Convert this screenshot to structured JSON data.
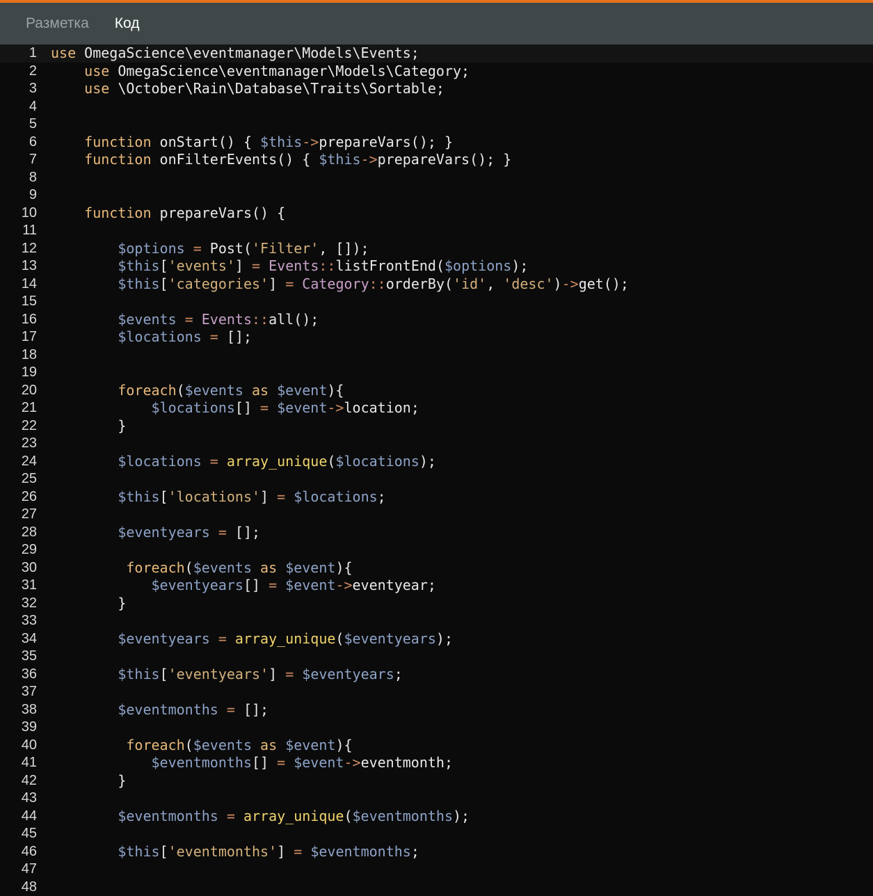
{
  "tabs": [
    {
      "label": "Разметка",
      "active": false
    },
    {
      "label": "Код",
      "active": true
    }
  ],
  "colors": {
    "accent": "#e8711d",
    "tabbar": "#3f4748",
    "editor_bg": "#0b0b0b"
  },
  "active_line": 1,
  "lines": [
    [
      [
        "kw",
        "use"
      ],
      [
        "plain",
        " OmegaScience\\eventmanager\\Models\\Events;"
      ]
    ],
    [
      [
        "plain",
        "    "
      ],
      [
        "kw",
        "use"
      ],
      [
        "plain",
        " OmegaScience\\eventmanager\\Models\\Category;"
      ]
    ],
    [
      [
        "plain",
        "    "
      ],
      [
        "kw",
        "use"
      ],
      [
        "plain",
        " \\October\\Rain\\Database\\Traits\\Sortable;"
      ]
    ],
    [],
    [],
    [
      [
        "plain",
        "    "
      ],
      [
        "kw",
        "function"
      ],
      [
        "plain",
        " onStart() { "
      ],
      [
        "var",
        "$this"
      ],
      [
        "op",
        "->"
      ],
      [
        "plain",
        "prepareVars(); }"
      ]
    ],
    [
      [
        "plain",
        "    "
      ],
      [
        "kw",
        "function"
      ],
      [
        "plain",
        " onFilterEvents() { "
      ],
      [
        "var",
        "$this"
      ],
      [
        "op",
        "->"
      ],
      [
        "plain",
        "prepareVars(); }"
      ]
    ],
    [],
    [],
    [
      [
        "plain",
        "    "
      ],
      [
        "kw",
        "function"
      ],
      [
        "plain",
        " prepareVars() {"
      ]
    ],
    [],
    [
      [
        "plain",
        "        "
      ],
      [
        "var",
        "$options"
      ],
      [
        "op",
        " = "
      ],
      [
        "plain",
        "Post("
      ],
      [
        "str",
        "'Filter'"
      ],
      [
        "plain",
        ", []);"
      ]
    ],
    [
      [
        "plain",
        "        "
      ],
      [
        "var",
        "$this"
      ],
      [
        "plain",
        "["
      ],
      [
        "str",
        "'events'"
      ],
      [
        "plain",
        "] "
      ],
      [
        "op",
        "="
      ],
      [
        "plain",
        " "
      ],
      [
        "cls",
        "Events"
      ],
      [
        "op",
        "::"
      ],
      [
        "plain",
        "listFrontEnd("
      ],
      [
        "var",
        "$options"
      ],
      [
        "plain",
        ");"
      ]
    ],
    [
      [
        "plain",
        "        "
      ],
      [
        "var",
        "$this"
      ],
      [
        "plain",
        "["
      ],
      [
        "str",
        "'categories'"
      ],
      [
        "plain",
        "] "
      ],
      [
        "op",
        "="
      ],
      [
        "plain",
        " "
      ],
      [
        "cls",
        "Category"
      ],
      [
        "op",
        "::"
      ],
      [
        "plain",
        "orderBy("
      ],
      [
        "str",
        "'id'"
      ],
      [
        "plain",
        ", "
      ],
      [
        "str",
        "'desc'"
      ],
      [
        "plain",
        ")"
      ],
      [
        "op",
        "->"
      ],
      [
        "plain",
        "get();"
      ]
    ],
    [],
    [
      [
        "plain",
        "        "
      ],
      [
        "var",
        "$events"
      ],
      [
        "op",
        " = "
      ],
      [
        "cls",
        "Events"
      ],
      [
        "op",
        "::"
      ],
      [
        "plain",
        "all();"
      ]
    ],
    [
      [
        "plain",
        "        "
      ],
      [
        "var",
        "$locations"
      ],
      [
        "op",
        " = "
      ],
      [
        "plain",
        "[];"
      ]
    ],
    [],
    [],
    [
      [
        "plain",
        "        "
      ],
      [
        "kw",
        "foreach"
      ],
      [
        "plain",
        "("
      ],
      [
        "var",
        "$events"
      ],
      [
        "kw",
        " as "
      ],
      [
        "var",
        "$event"
      ],
      [
        "plain",
        "){"
      ]
    ],
    [
      [
        "plain",
        "            "
      ],
      [
        "var",
        "$locations"
      ],
      [
        "plain",
        "[] "
      ],
      [
        "op",
        "="
      ],
      [
        "plain",
        " "
      ],
      [
        "var",
        "$event"
      ],
      [
        "op",
        "->"
      ],
      [
        "plain",
        "location;"
      ]
    ],
    [
      [
        "plain",
        "        }"
      ]
    ],
    [],
    [
      [
        "plain",
        "        "
      ],
      [
        "var",
        "$locations"
      ],
      [
        "op",
        " = "
      ],
      [
        "bi",
        "array_unique"
      ],
      [
        "plain",
        "("
      ],
      [
        "var",
        "$locations"
      ],
      [
        "plain",
        ");"
      ]
    ],
    [],
    [
      [
        "plain",
        "        "
      ],
      [
        "var",
        "$this"
      ],
      [
        "plain",
        "["
      ],
      [
        "str",
        "'locations'"
      ],
      [
        "plain",
        "] "
      ],
      [
        "op",
        "="
      ],
      [
        "plain",
        " "
      ],
      [
        "var",
        "$locations"
      ],
      [
        "plain",
        ";"
      ]
    ],
    [],
    [
      [
        "plain",
        "        "
      ],
      [
        "var",
        "$eventyears"
      ],
      [
        "op",
        " = "
      ],
      [
        "plain",
        "[];"
      ]
    ],
    [],
    [
      [
        "plain",
        "         "
      ],
      [
        "kw",
        "foreach"
      ],
      [
        "plain",
        "("
      ],
      [
        "var",
        "$events"
      ],
      [
        "kw",
        " as "
      ],
      [
        "var",
        "$event"
      ],
      [
        "plain",
        "){"
      ]
    ],
    [
      [
        "plain",
        "            "
      ],
      [
        "var",
        "$eventyears"
      ],
      [
        "plain",
        "[] "
      ],
      [
        "op",
        "="
      ],
      [
        "plain",
        " "
      ],
      [
        "var",
        "$event"
      ],
      [
        "op",
        "->"
      ],
      [
        "plain",
        "eventyear;"
      ]
    ],
    [
      [
        "plain",
        "        }"
      ]
    ],
    [],
    [
      [
        "plain",
        "        "
      ],
      [
        "var",
        "$eventyears"
      ],
      [
        "op",
        " = "
      ],
      [
        "bi",
        "array_unique"
      ],
      [
        "plain",
        "("
      ],
      [
        "var",
        "$eventyears"
      ],
      [
        "plain",
        ");"
      ]
    ],
    [],
    [
      [
        "plain",
        "        "
      ],
      [
        "var",
        "$this"
      ],
      [
        "plain",
        "["
      ],
      [
        "str",
        "'eventyears'"
      ],
      [
        "plain",
        "] "
      ],
      [
        "op",
        "="
      ],
      [
        "plain",
        " "
      ],
      [
        "var",
        "$eventyears"
      ],
      [
        "plain",
        ";"
      ]
    ],
    [],
    [
      [
        "plain",
        "        "
      ],
      [
        "var",
        "$eventmonths"
      ],
      [
        "op",
        " = "
      ],
      [
        "plain",
        "[];"
      ]
    ],
    [],
    [
      [
        "plain",
        "         "
      ],
      [
        "kw",
        "foreach"
      ],
      [
        "plain",
        "("
      ],
      [
        "var",
        "$events"
      ],
      [
        "kw",
        " as "
      ],
      [
        "var",
        "$event"
      ],
      [
        "plain",
        "){"
      ]
    ],
    [
      [
        "plain",
        "            "
      ],
      [
        "var",
        "$eventmonths"
      ],
      [
        "plain",
        "[] "
      ],
      [
        "op",
        "="
      ],
      [
        "plain",
        " "
      ],
      [
        "var",
        "$event"
      ],
      [
        "op",
        "->"
      ],
      [
        "plain",
        "eventmonth;"
      ]
    ],
    [
      [
        "plain",
        "        }"
      ]
    ],
    [],
    [
      [
        "plain",
        "        "
      ],
      [
        "var",
        "$eventmonths"
      ],
      [
        "op",
        " = "
      ],
      [
        "bi",
        "array_unique"
      ],
      [
        "plain",
        "("
      ],
      [
        "var",
        "$eventmonths"
      ],
      [
        "plain",
        ");"
      ]
    ],
    [],
    [
      [
        "plain",
        "        "
      ],
      [
        "var",
        "$this"
      ],
      [
        "plain",
        "["
      ],
      [
        "str",
        "'eventmonths'"
      ],
      [
        "plain",
        "] "
      ],
      [
        "op",
        "="
      ],
      [
        "plain",
        " "
      ],
      [
        "var",
        "$eventmonths"
      ],
      [
        "plain",
        ";"
      ]
    ],
    [],
    []
  ]
}
